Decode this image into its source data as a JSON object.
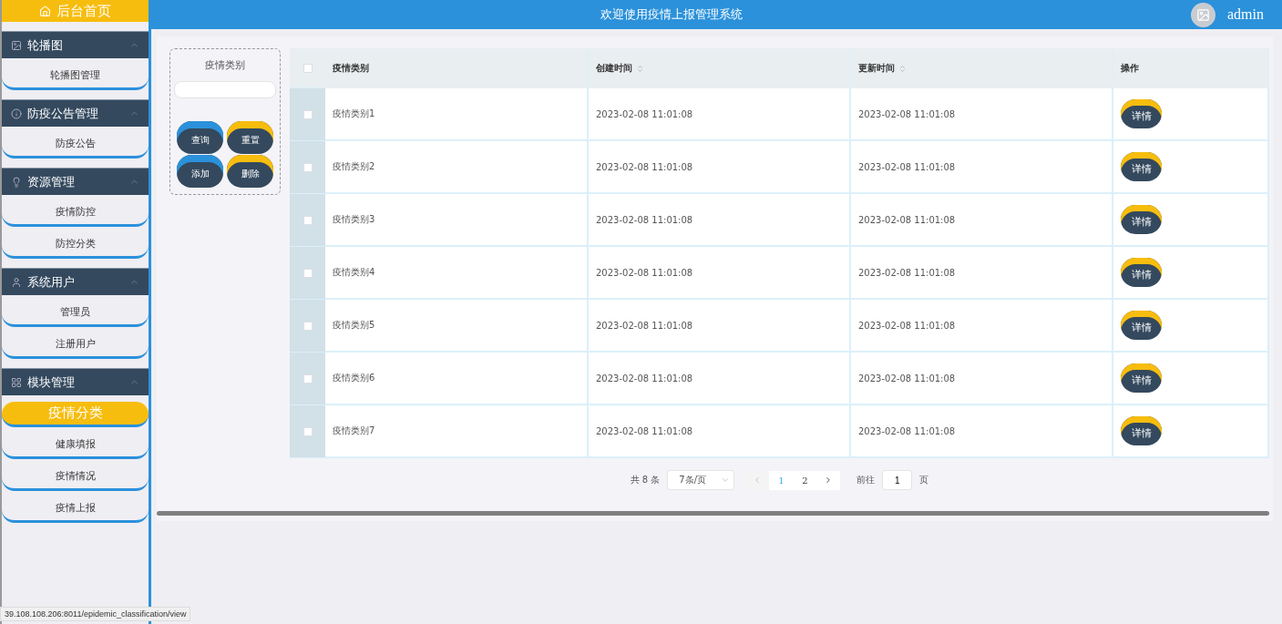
{
  "sidebar": {
    "home": "后台首页",
    "groups": [
      {
        "title": "轮播图",
        "expanded": true,
        "items": [
          {
            "label": "轮播图管理",
            "selected": false
          }
        ]
      },
      {
        "title": "防疫公告管理",
        "expanded": true,
        "items": [
          {
            "label": "防疫公告",
            "selected": false
          }
        ]
      },
      {
        "title": "资源管理",
        "expanded": true,
        "items": [
          {
            "label": "疫情防控",
            "selected": false
          },
          {
            "label": "防控分类",
            "selected": false
          }
        ]
      },
      {
        "title": "系统用户",
        "expanded": true,
        "items": [
          {
            "label": "管理员",
            "selected": false
          },
          {
            "label": "注册用户",
            "selected": false
          }
        ]
      },
      {
        "title": "模块管理",
        "expanded": true,
        "items": [
          {
            "label": "疫情分类",
            "selected": true
          },
          {
            "label": "健康填报",
            "selected": false
          },
          {
            "label": "疫情情况",
            "selected": false
          },
          {
            "label": "疫情上报",
            "selected": false
          }
        ]
      }
    ]
  },
  "header": {
    "title": "欢迎使用疫情上报管理系统",
    "user": "admin"
  },
  "search": {
    "label": "疫情类别",
    "buttons": [
      {
        "label": "查询",
        "color": "#2b91db"
      },
      {
        "label": "重置",
        "color": "#f7bd0e"
      },
      {
        "label": "添加",
        "color": "#2b91db"
      },
      {
        "label": "删除",
        "color": "#f7bd0e"
      }
    ]
  },
  "table": {
    "all_checked": false,
    "columns": [
      {
        "label": "疫情类别",
        "sortable": false
      },
      {
        "label": "创建时间",
        "sortable": true
      },
      {
        "label": "更新时间",
        "sortable": true
      },
      {
        "label": "操作",
        "sortable": false
      }
    ],
    "rows": [
      {
        "checked": false,
        "cells": [
          "疫情类别1",
          "2023-02-08 11:01:08",
          "2023-02-08 11:01:08"
        ],
        "action": "详情"
      },
      {
        "checked": false,
        "cells": [
          "疫情类别2",
          "2023-02-08 11:01:08",
          "2023-02-08 11:01:08"
        ],
        "action": "详情"
      },
      {
        "checked": false,
        "cells": [
          "疫情类别3",
          "2023-02-08 11:01:08",
          "2023-02-08 11:01:08"
        ],
        "action": "详情"
      },
      {
        "checked": false,
        "cells": [
          "疫情类别4",
          "2023-02-08 11:01:08",
          "2023-02-08 11:01:08"
        ],
        "action": "详情"
      },
      {
        "checked": false,
        "cells": [
          "疫情类别5",
          "2023-02-08 11:01:08",
          "2023-02-08 11:01:08"
        ],
        "action": "详情"
      },
      {
        "checked": false,
        "cells": [
          "疫情类别6",
          "2023-02-08 11:01:08",
          "2023-02-08 11:01:08"
        ],
        "action": "详情"
      },
      {
        "checked": false,
        "cells": [
          "疫情类别7",
          "2023-02-08 11:01:08",
          "2023-02-08 11:01:08"
        ],
        "action": "详情"
      }
    ]
  },
  "pagination": {
    "total": "共 8 条",
    "page_size": "7条/页",
    "prev_disabled": true,
    "pages": [
      {
        "label": "1",
        "selected": true
      },
      {
        "label": "2",
        "selected": false
      }
    ],
    "goto_label": "前往",
    "goto_value": "1",
    "goto_suffix": "页"
  },
  "status_bar": "39.108.108.206:8011/epidemic_classification/view"
}
